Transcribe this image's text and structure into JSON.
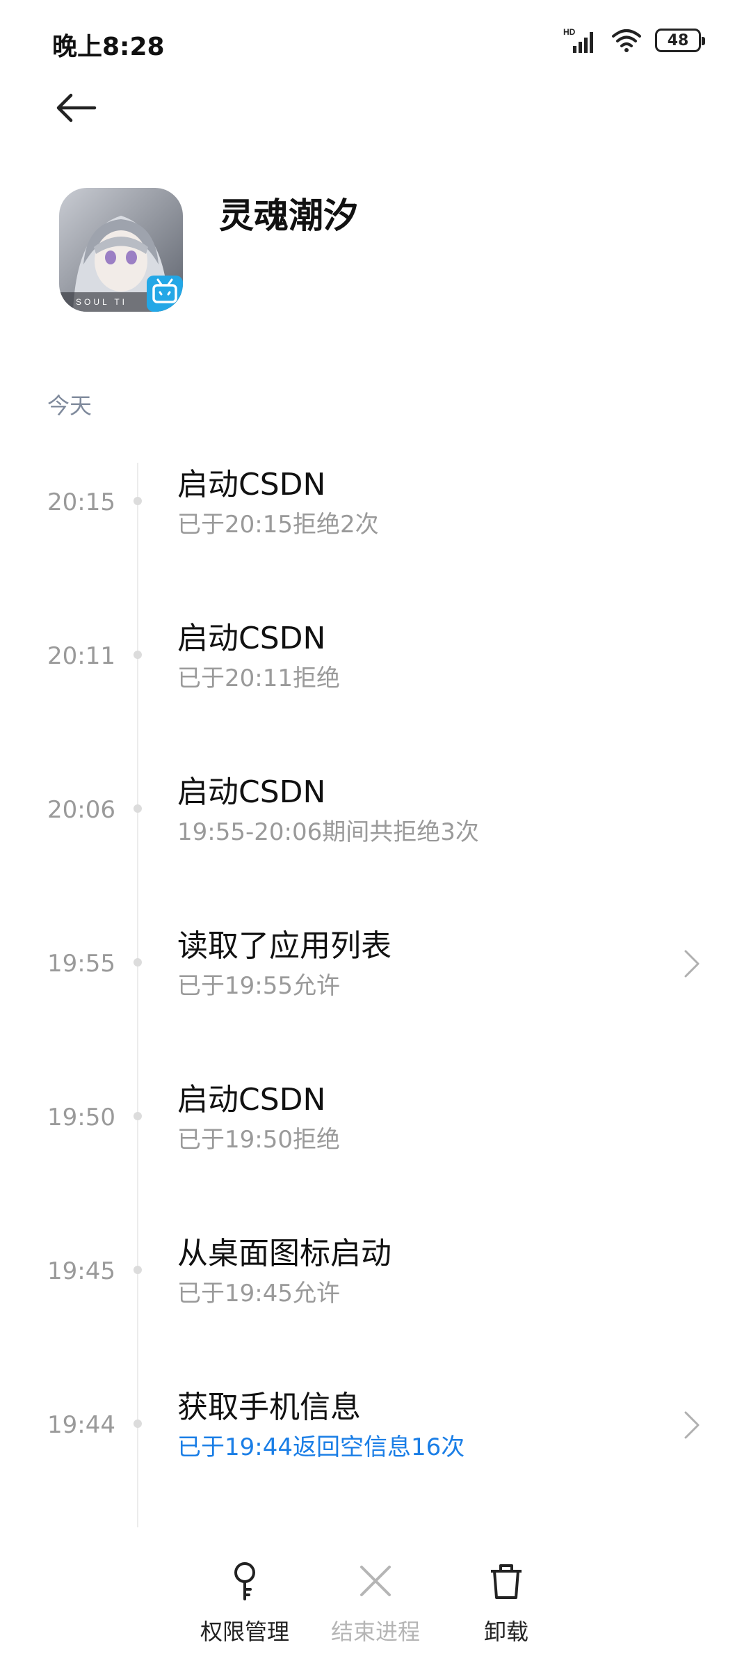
{
  "status_bar": {
    "time": "晚上8:28",
    "network_label": "HD",
    "battery": "48"
  },
  "header": {
    "back_icon": "back-arrow-icon",
    "app_name": "灵魂潮汐",
    "app_icon_text": "SOUL TI"
  },
  "section": {
    "label": "今天"
  },
  "timeline": [
    {
      "time": "20:15",
      "title": "启动CSDN",
      "subtitle": "已于20:15拒绝2次",
      "has_chevron": false,
      "subtitle_color": "#9a9a9a"
    },
    {
      "time": "20:11",
      "title": "启动CSDN",
      "subtitle": "已于20:11拒绝",
      "has_chevron": false,
      "subtitle_color": "#9a9a9a"
    },
    {
      "time": "20:06",
      "title": "启动CSDN",
      "subtitle": "19:55-20:06期间共拒绝3次",
      "has_chevron": false,
      "subtitle_color": "#9a9a9a"
    },
    {
      "time": "19:55",
      "title": "读取了应用列表",
      "subtitle": "已于19:55允许",
      "has_chevron": true,
      "subtitle_color": "#9a9a9a"
    },
    {
      "time": "19:50",
      "title": "启动CSDN",
      "subtitle": "已于19:50拒绝",
      "has_chevron": false,
      "subtitle_color": "#9a9a9a"
    },
    {
      "time": "19:45",
      "title": "从桌面图标启动",
      "subtitle": "已于19:45允许",
      "has_chevron": false,
      "subtitle_color": "#9a9a9a"
    },
    {
      "time": "19:44",
      "title": "获取手机信息",
      "subtitle": "已于19:44返回空信息16次",
      "has_chevron": true,
      "subtitle_color": "#1a7ee6"
    }
  ],
  "bottom_bar": {
    "permissions_label": "权限管理",
    "end_process_label": "结束进程",
    "uninstall_label": "卸载"
  },
  "colors": {
    "accent_blue": "#1a7ee6",
    "muted_text": "#9a9a9a",
    "section_label": "#7f8a9c"
  }
}
